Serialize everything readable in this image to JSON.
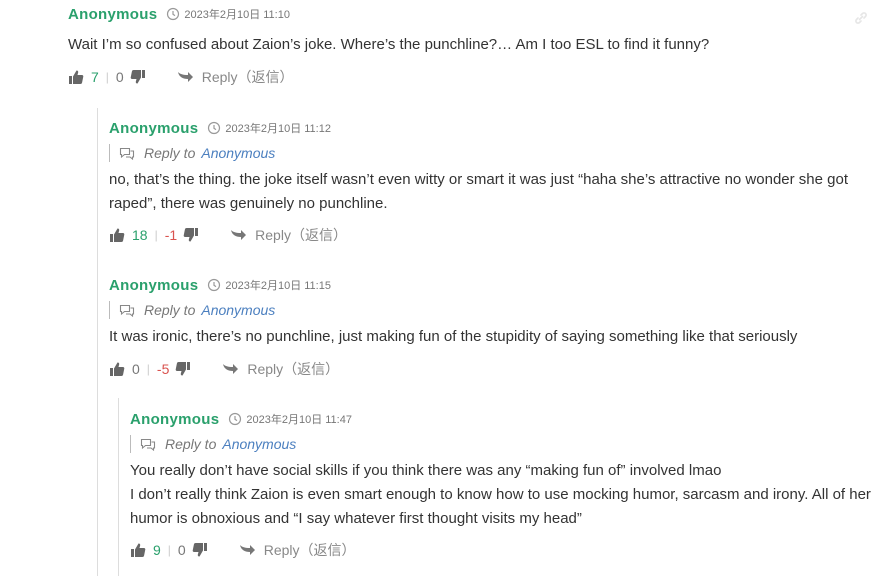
{
  "comments": [
    {
      "author": "Anonymous",
      "time": "2023年2月10日 11:10",
      "reply_to": null,
      "body": [
        "Wait I’m so confused about Zaion’s joke. Where’s the punchline?… Am I too ESL to find it funny?"
      ],
      "up": "7",
      "down": "0",
      "reply_label": "Reply（返信）"
    },
    {
      "author": "Anonymous",
      "time": "2023年2月10日 11:12",
      "reply_to": "Anonymous",
      "body": [
        "no, that’s the thing. the joke itself wasn’t even witty or smart it was just “haha she’s attractive no wonder she got",
        "raped”, there was genuinely no punchline."
      ],
      "up": "18",
      "down": "-1",
      "reply_label": "Reply（返信）"
    },
    {
      "author": "Anonymous",
      "time": "2023年2月10日 11:15",
      "reply_to": "Anonymous",
      "body": [
        "It was ironic, there’s no punchline, just making fun of the stupidity of saying something like that seriously"
      ],
      "up": "0",
      "down": "-5",
      "reply_label": "Reply（返信）"
    },
    {
      "author": "Anonymous",
      "time": "2023年2月10日 11:47",
      "reply_to": "Anonymous",
      "body": [
        "You really don’t have social skills if you think there was any “making fun of” involved lmao",
        "I don’t really think Zaion is even smart enough to know how to use mocking humor, sarcasm and irony. All of her",
        "humor is obnoxious and “I say whatever first thought visits my head”"
      ],
      "up": "9",
      "down": "0",
      "reply_label": "Reply（返信）"
    }
  ],
  "reply_to_prefix": "Reply to",
  "colors": {
    "author": "#2aa06c",
    "link": "#4b7fbf",
    "negative": "#d9534f"
  },
  "icons": [
    "clock-icon",
    "thumbs-up-icon",
    "thumbs-down-icon",
    "reply-arrow-icon",
    "chat-bubble-icon",
    "link-icon"
  ]
}
